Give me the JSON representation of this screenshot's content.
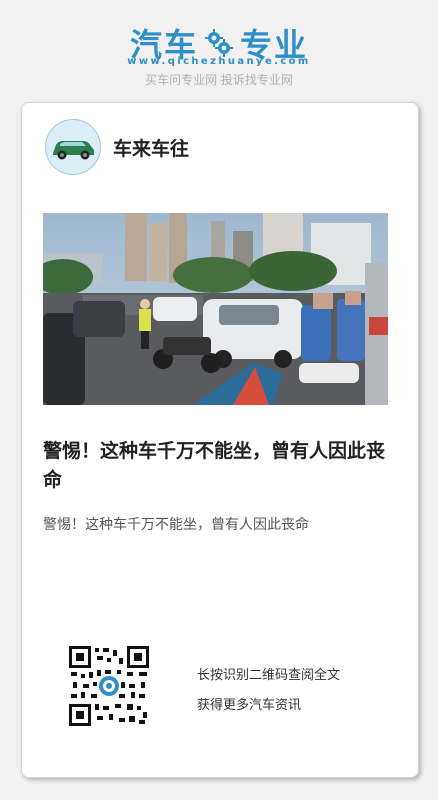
{
  "header": {
    "logo_part1": "汽车",
    "logo_part2": "专业",
    "url": "www.qichezhuanye.com",
    "slogan": "买车问专业网 投诉找专业网"
  },
  "card": {
    "author": "车来车往",
    "title": "警惕！这种车千万不能坐，曾有人因此丧命",
    "description": "警惕！这种车千万不能坐，曾有人因此丧命",
    "qr_line1": "长按识别二维码查阅全文",
    "qr_line2": "获得更多汽车资讯"
  },
  "colors": {
    "brand": "#2f8fc6",
    "slogan": "#b1b1b1"
  }
}
